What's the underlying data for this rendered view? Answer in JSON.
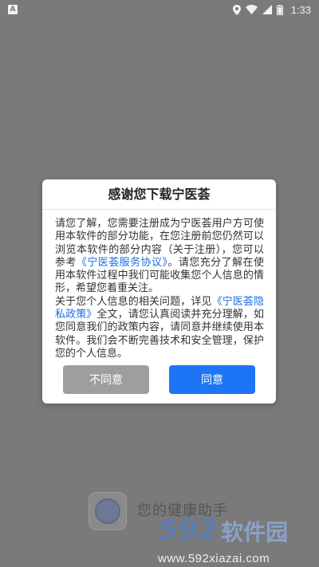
{
  "status_bar": {
    "app_indicator": "A",
    "time": "1:33"
  },
  "background": {
    "slogan": "您的健康助手"
  },
  "watermark": {
    "logo_number": "592",
    "logo_name": "软件园",
    "url": "www.592xiazai.com"
  },
  "dialog": {
    "title": "感谢您下载宁医荟",
    "body": {
      "p1": "请您了解，您需要注册成为宁医荟用户方可使用本软件的部分功能，在您注册前您仍然可以浏览本软件的部分内容（关于注册），您可以参考",
      "p1_link": "《宁医荟服务协议》",
      "p1_tail": "。请您充分了解在使用本软件过程中我们可能收集您个人信息的情形，希望您着重关注。",
      "p2": "关于您个人信息的相关问题，详见",
      "p2_link": "《宁医荟隐私政策》",
      "p2_tail": "全文，请您认真阅读并充分理解，如您同意我们的政策内容，请同意并继续使用本软件。我们会不断完善技术和安全管理，保护您的个人信息。"
    },
    "disagree_label": "不同意",
    "agree_label": "同意"
  },
  "colors": {
    "overlay": "#7a7a7a",
    "link": "#1e6fe6",
    "agree": "#1d74f5",
    "disagree": "#9e9e9e"
  }
}
